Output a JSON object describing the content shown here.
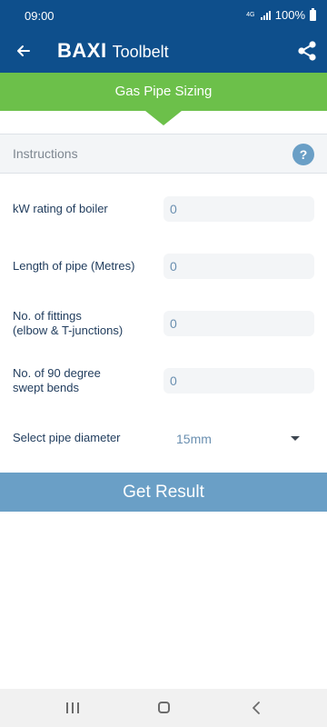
{
  "status_bar": {
    "time": "09:00",
    "network": "4G",
    "battery": "100%"
  },
  "app_bar": {
    "logo_text": "BAXI",
    "app_name": "Toolbelt",
    "back_icon": "arrow-left-icon",
    "share_icon": "share-icon"
  },
  "banner": {
    "title": "Gas Pipe Sizing"
  },
  "instructions": {
    "label": "Instructions",
    "help_symbol": "?"
  },
  "fields": [
    {
      "label_lines": [
        "kW rating of boiler"
      ],
      "value": "0"
    },
    {
      "label_lines": [
        "Length of pipe (Metres)"
      ],
      "value": "0"
    },
    {
      "label_lines": [
        "No. of fittings",
        "(elbow & T-junctions)"
      ],
      "value": "0"
    },
    {
      "label_lines": [
        "No. of 90 degree",
        "swept bends"
      ],
      "value": "0"
    }
  ],
  "pipe_diameter": {
    "label": "Select pipe diameter",
    "selected": "15mm"
  },
  "result_button": {
    "label": "Get Result"
  },
  "colors": {
    "primary": "#0e4f8c",
    "accent_green": "#6cc04a",
    "button_blue": "#6a9fc6",
    "input_bg": "#f3f5f7"
  }
}
